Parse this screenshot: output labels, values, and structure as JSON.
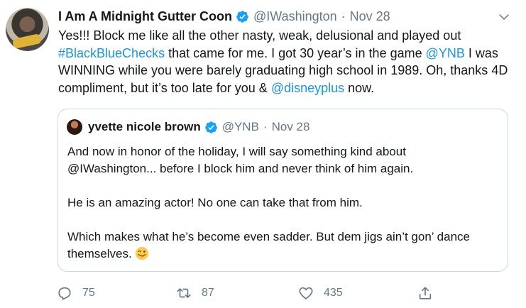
{
  "author": {
    "name": "I Am A Midnight Gutter Coon",
    "handle": "@IWashington",
    "separator": "·",
    "date": "Nov 28"
  },
  "tweet": {
    "text_1": "Yes!!! Block me like all the other nasty, weak, delusional and played out ",
    "hashtag": "#BlackBlueChecks",
    "text_2": " that came for me. I got 30 year’s in the game ",
    "mention_1": "@YNB",
    "text_3": " I was WINNING while you were barely graduating high school in 1989. Oh, thanks 4D compliment, but it’s too late for you & ",
    "mention_2": "@disneyplus",
    "text_4": " now."
  },
  "quoted": {
    "name": "yvette nicole brown",
    "handle": "@YNB",
    "separator": "·",
    "date": "Nov 28",
    "paragraph_1": "And now in honor of the holiday, I will say something kind about @IWashington... before I block him and never think of him again.",
    "paragraph_2": "He is an amazing actor! No one can take that from him.",
    "paragraph_3": "Which makes what he’s become even sadder. But dem jigs ain’t gon’ dance themselves."
  },
  "actions": {
    "reply_count": "75",
    "retweet_count": "87",
    "like_count": "435"
  },
  "icons": {
    "verified": "verified-badge-icon",
    "caret": "chevron-down-icon",
    "reply": "reply-icon",
    "retweet": "retweet-icon",
    "like": "heart-icon",
    "share": "share-icon",
    "emoji": "winking-face-with-tongue-emoji"
  },
  "colors": {
    "link": "#1b95e0",
    "verified": "#1da1f2",
    "secondary_text": "#657786",
    "border": "#ccd6dd"
  }
}
